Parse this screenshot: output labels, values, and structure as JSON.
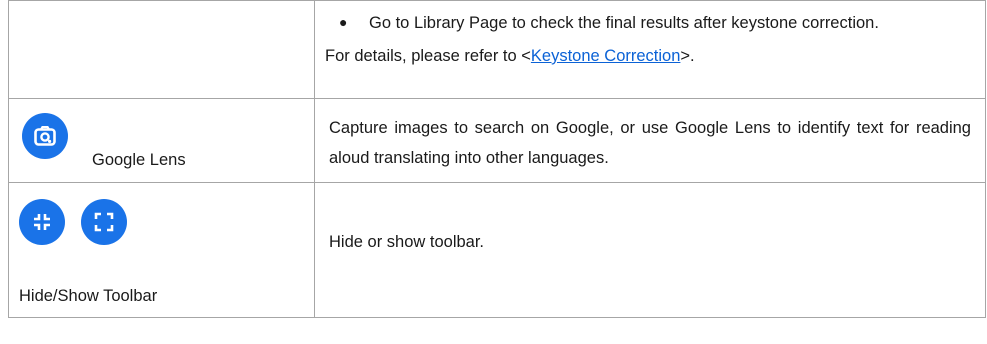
{
  "rows": [
    {
      "bullet": "Go to Library Page to check the final results after keystone correction.",
      "details_prefix": "For details, please refer to <",
      "details_link": "Keystone Correction",
      "details_suffix": ">."
    },
    {
      "icon": "google-lens-icon",
      "label": "Google Lens",
      "description": "Capture images to search on Google, or use Google Lens to identify text for reading aloud translating into other languages."
    },
    {
      "icons": [
        "collapse-icon",
        "expand-icon"
      ],
      "label": "Hide/Show Toolbar",
      "description": "Hide or show toolbar."
    }
  ],
  "colors": {
    "icon_blue": "#1a73e8",
    "link": "#0b62d6",
    "border": "#a6a6a6"
  }
}
